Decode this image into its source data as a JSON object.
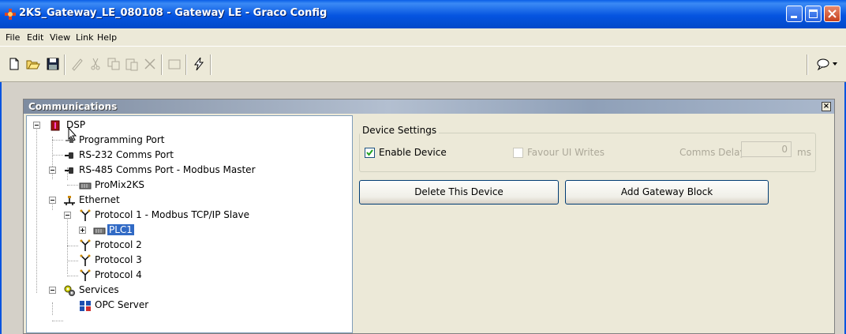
{
  "window": {
    "title": "2KS_Gateway_LE_080108 - Gateway LE - Graco Config"
  },
  "menu": [
    "File",
    "Edit",
    "View",
    "Link",
    "Help"
  ],
  "toolbar": {
    "icons": [
      "new-file-icon",
      "open-folder-icon",
      "save-icon",
      "pen-icon",
      "cut-icon",
      "copy-icon",
      "paste-icon",
      "delete-icon",
      "rectangle-icon",
      "lightning-icon",
      "comment-icon"
    ]
  },
  "communications": {
    "title": "Communications",
    "tree": {
      "dsp": "DSP",
      "programming_port": "Programming Port",
      "rs232": "RS-232 Comms Port",
      "rs485": "RS-485 Comms Port - Modbus Master",
      "promix": "ProMix2KS",
      "ethernet": "Ethernet",
      "protocol1": "Protocol 1 - Modbus TCP/IP Slave",
      "plc1": "PLC1",
      "protocol2": "Protocol 2",
      "protocol3": "Protocol 3",
      "protocol4": "Protocol 4",
      "services": "Services",
      "opc": "OPC Server"
    },
    "settings": {
      "group_label": "Device Settings",
      "enable_device": "Enable Device",
      "enable_device_checked": true,
      "favour_ui_writes": "Favour UI Writes",
      "favour_ui_writes_checked": false,
      "comms_delay_label": "Comms Delay:",
      "comms_delay_value": "0",
      "comms_delay_unit": "ms"
    },
    "buttons": {
      "delete": "Delete This Device",
      "add_block": "Add Gateway Block"
    }
  }
}
